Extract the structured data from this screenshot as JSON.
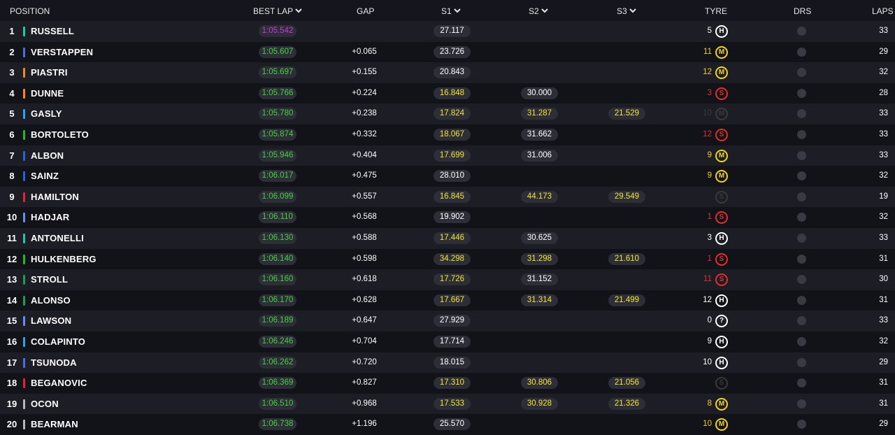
{
  "header": {
    "position": "POSITION",
    "best_lap": "BEST LAP",
    "gap": "GAP",
    "s1": "S1",
    "s2": "S2",
    "s3": "S3",
    "tyre": "TYRE",
    "drs": "DRS",
    "laps": "LAPS"
  },
  "colors": {
    "purple": "#c43ad6",
    "green": "#3fd43c",
    "yellow": "#f3e532",
    "white": "#ffffff",
    "soft": "#e0302c",
    "medium": "#f2d31c",
    "hard": "#ffffff",
    "faded": "#3a3a3a"
  },
  "rows": [
    {
      "pos": "1",
      "name": "RUSSELL",
      "team": "#27c4a8",
      "best": "1:05.542",
      "best_c": "purple",
      "gap": "",
      "s1": "27.117",
      "s1_c": "white",
      "s2": "",
      "s2_c": "white",
      "s3": "",
      "s3_c": "white",
      "age": "5",
      "tyre": "H",
      "tyre_c": "hard",
      "laps": "33"
    },
    {
      "pos": "2",
      "name": "VERSTAPPEN",
      "team": "#4a6fd8",
      "best": "1:05.607",
      "best_c": "green",
      "gap": "+0.065",
      "s1": "23.726",
      "s1_c": "white",
      "s2": "",
      "s2_c": "white",
      "s3": "",
      "s3_c": "white",
      "age": "11",
      "tyre": "M",
      "tyre_c": "medium",
      "laps": "29"
    },
    {
      "pos": "3",
      "name": "PIASTRI",
      "team": "#f08a22",
      "best": "1:05.697",
      "best_c": "green",
      "gap": "+0.155",
      "s1": "20.843",
      "s1_c": "white",
      "s2": "",
      "s2_c": "white",
      "s3": "",
      "s3_c": "white",
      "age": "12",
      "tyre": "M",
      "tyre_c": "medium",
      "laps": "32"
    },
    {
      "pos": "4",
      "name": "DUNNE",
      "team": "#f08a22",
      "best": "1:05.766",
      "best_c": "green",
      "gap": "+0.224",
      "s1": "16.848",
      "s1_c": "yellow",
      "s2": "30.000",
      "s2_c": "white",
      "s3": "",
      "s3_c": "white",
      "age": "3",
      "tyre": "S",
      "tyre_c": "soft",
      "laps": "28"
    },
    {
      "pos": "5",
      "name": "GASLY",
      "team": "#2aa4e6",
      "best": "1:05.780",
      "best_c": "green",
      "gap": "+0.238",
      "s1": "17.824",
      "s1_c": "yellow",
      "s2": "31.287",
      "s2_c": "yellow",
      "s3": "21.529",
      "s3_c": "yellow",
      "age": "10",
      "tyre": "M",
      "tyre_c": "faded",
      "laps": "33"
    },
    {
      "pos": "6",
      "name": "BORTOLETO",
      "team": "#26b33c",
      "best": "1:05.874",
      "best_c": "green",
      "gap": "+0.332",
      "s1": "18.067",
      "s1_c": "yellow",
      "s2": "31.662",
      "s2_c": "white",
      "s3": "",
      "s3_c": "white",
      "age": "12",
      "tyre": "S",
      "tyre_c": "soft",
      "laps": "33"
    },
    {
      "pos": "7",
      "name": "ALBON",
      "team": "#2a63d8",
      "best": "1:05.946",
      "best_c": "green",
      "gap": "+0.404",
      "s1": "17.699",
      "s1_c": "yellow",
      "s2": "31.006",
      "s2_c": "white",
      "s3": "",
      "s3_c": "white",
      "age": "9",
      "tyre": "M",
      "tyre_c": "medium",
      "laps": "33"
    },
    {
      "pos": "8",
      "name": "SAINZ",
      "team": "#2a63d8",
      "best": "1:06.017",
      "best_c": "green",
      "gap": "+0.475",
      "s1": "28.010",
      "s1_c": "white",
      "s2": "",
      "s2_c": "white",
      "s3": "",
      "s3_c": "white",
      "age": "9",
      "tyre": "M",
      "tyre_c": "medium",
      "laps": "32"
    },
    {
      "pos": "9",
      "name": "HAMILTON",
      "team": "#e0253a",
      "best": "1:06.099",
      "best_c": "green",
      "gap": "+0.557",
      "s1": "16.845",
      "s1_c": "yellow",
      "s2": "44.173",
      "s2_c": "yellow",
      "s3": "29.549",
      "s3_c": "yellow",
      "age": "",
      "tyre": "S",
      "tyre_c": "faded",
      "laps": "19"
    },
    {
      "pos": "10",
      "name": "HADJAR",
      "team": "#6a8ee8",
      "best": "1:06.110",
      "best_c": "green",
      "gap": "+0.568",
      "s1": "19.902",
      "s1_c": "white",
      "s2": "",
      "s2_c": "white",
      "s3": "",
      "s3_c": "white",
      "age": "1",
      "tyre": "S",
      "tyre_c": "soft",
      "laps": "32"
    },
    {
      "pos": "11",
      "name": "ANTONELLI",
      "team": "#27c4a8",
      "best": "1:06.130",
      "best_c": "green",
      "gap": "+0.588",
      "s1": "17.446",
      "s1_c": "yellow",
      "s2": "30.625",
      "s2_c": "white",
      "s3": "",
      "s3_c": "white",
      "age": "3",
      "tyre": "H",
      "tyre_c": "hard",
      "laps": "33"
    },
    {
      "pos": "12",
      "name": "HULKENBERG",
      "team": "#26b33c",
      "best": "1:06.140",
      "best_c": "green",
      "gap": "+0.598",
      "s1": "34.298",
      "s1_c": "yellow",
      "s2": "31.298",
      "s2_c": "yellow",
      "s3": "21.610",
      "s3_c": "yellow",
      "age": "1",
      "tyre": "S",
      "tyre_c": "soft",
      "laps": "31"
    },
    {
      "pos": "13",
      "name": "STROLL",
      "team": "#1f9a5a",
      "best": "1:06.160",
      "best_c": "green",
      "gap": "+0.618",
      "s1": "17.726",
      "s1_c": "yellow",
      "s2": "31.152",
      "s2_c": "white",
      "s3": "",
      "s3_c": "white",
      "age": "11",
      "tyre": "S",
      "tyre_c": "soft",
      "laps": "30"
    },
    {
      "pos": "14",
      "name": "ALONSO",
      "team": "#1f9a5a",
      "best": "1:06.170",
      "best_c": "green",
      "gap": "+0.628",
      "s1": "17.667",
      "s1_c": "yellow",
      "s2": "31.314",
      "s2_c": "yellow",
      "s3": "21.499",
      "s3_c": "yellow",
      "age": "12",
      "tyre": "H",
      "tyre_c": "hard",
      "laps": "31"
    },
    {
      "pos": "15",
      "name": "LAWSON",
      "team": "#6a8ee8",
      "best": "1:06.189",
      "best_c": "green",
      "gap": "+0.647",
      "s1": "27.929",
      "s1_c": "white",
      "s2": "",
      "s2_c": "white",
      "s3": "",
      "s3_c": "white",
      "age": "0",
      "tyre": "?",
      "tyre_c": "hard",
      "laps": "33"
    },
    {
      "pos": "16",
      "name": "COLAPINTO",
      "team": "#2aa4e6",
      "best": "1:06.246",
      "best_c": "green",
      "gap": "+0.704",
      "s1": "17.714",
      "s1_c": "white",
      "s2": "",
      "s2_c": "white",
      "s3": "",
      "s3_c": "white",
      "age": "9",
      "tyre": "H",
      "tyre_c": "hard",
      "laps": "32"
    },
    {
      "pos": "17",
      "name": "TSUNODA",
      "team": "#4a6fd8",
      "best": "1:06.262",
      "best_c": "green",
      "gap": "+0.720",
      "s1": "18.015",
      "s1_c": "white",
      "s2": "",
      "s2_c": "white",
      "s3": "",
      "s3_c": "white",
      "age": "10",
      "tyre": "H",
      "tyre_c": "hard",
      "laps": "29"
    },
    {
      "pos": "18",
      "name": "BEGANOVIC",
      "team": "#e0253a",
      "best": "1:06.369",
      "best_c": "green",
      "gap": "+0.827",
      "s1": "17.310",
      "s1_c": "yellow",
      "s2": "30.806",
      "s2_c": "yellow",
      "s3": "21.056",
      "s3_c": "yellow",
      "age": "",
      "tyre": "S",
      "tyre_c": "faded",
      "laps": "31"
    },
    {
      "pos": "19",
      "name": "OCON",
      "team": "#b6b6bc",
      "best": "1:06.510",
      "best_c": "green",
      "gap": "+0.968",
      "s1": "17.533",
      "s1_c": "yellow",
      "s2": "30.928",
      "s2_c": "yellow",
      "s3": "21.326",
      "s3_c": "yellow",
      "age": "8",
      "tyre": "M",
      "tyre_c": "medium",
      "laps": "31"
    },
    {
      "pos": "20",
      "name": "BEARMAN",
      "team": "#b6b6bc",
      "best": "1:06.738",
      "best_c": "green",
      "gap": "+1.196",
      "s1": "25.570",
      "s1_c": "white",
      "s2": "",
      "s2_c": "white",
      "s3": "",
      "s3_c": "white",
      "age": "10",
      "tyre": "M",
      "tyre_c": "medium",
      "laps": "29"
    }
  ]
}
